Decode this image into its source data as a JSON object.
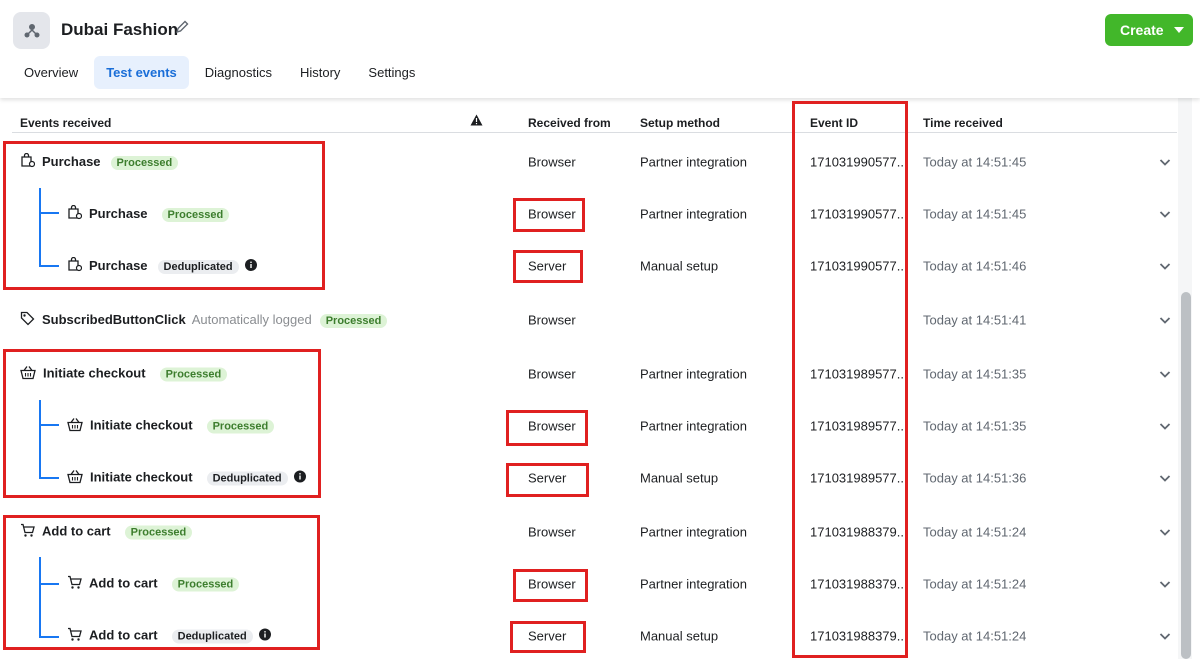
{
  "app": {
    "title": "Dubai Fashion",
    "create_label": "Create"
  },
  "tabs": [
    "Overview",
    "Test events",
    "Diagnostics",
    "History",
    "Settings"
  ],
  "columns": {
    "events_received": "Events received",
    "received_from": "Received from",
    "setup_method": "Setup method",
    "event_id": "Event ID",
    "time_received": "Time received"
  },
  "rows": [
    {
      "name": "Purchase",
      "badge": "Processed",
      "from": "Browser",
      "setup": "Partner integration",
      "id": "171031990577...",
      "time": "Today at 14:51:45"
    },
    {
      "name": "Purchase",
      "badge": "Processed",
      "from": "Browser",
      "setup": "Partner integration",
      "id": "171031990577...",
      "time": "Today at 14:51:45"
    },
    {
      "name": "Purchase",
      "badge": "Deduplicated",
      "from": "Server",
      "setup": "Manual setup",
      "id": "171031990577...",
      "time": "Today at 14:51:46"
    },
    {
      "name": "SubscribedButtonClick",
      "auto": "Automatically logged",
      "badge": "Processed",
      "from": "Browser",
      "setup": "",
      "id": "",
      "time": "Today at 14:51:41"
    },
    {
      "name": "Initiate checkout",
      "badge": "Processed",
      "from": "Browser",
      "setup": "Partner integration",
      "id": "171031989577...",
      "time": "Today at 14:51:35"
    },
    {
      "name": "Initiate checkout",
      "badge": "Processed",
      "from": "Browser",
      "setup": "Partner integration",
      "id": "171031989577...",
      "time": "Today at 14:51:35"
    },
    {
      "name": "Initiate checkout",
      "badge": "Deduplicated",
      "from": "Server",
      "setup": "Manual setup",
      "id": "171031989577...",
      "time": "Today at 14:51:36"
    },
    {
      "name": "Add to cart",
      "badge": "Processed",
      "from": "Browser",
      "setup": "Partner integration",
      "id": "171031988379...",
      "time": "Today at 14:51:24"
    },
    {
      "name": "Add to cart",
      "badge": "Processed",
      "from": "Browser",
      "setup": "Partner integration",
      "id": "171031988379...",
      "time": "Today at 14:51:24"
    },
    {
      "name": "Add to cart",
      "badge": "Deduplicated",
      "from": "Server",
      "setup": "Manual setup",
      "id": "171031988379...",
      "time": "Today at 14:51:24"
    }
  ],
  "colors": {
    "create": "#42b72a",
    "highlight": "#e02020",
    "tree": "#1877f2"
  }
}
